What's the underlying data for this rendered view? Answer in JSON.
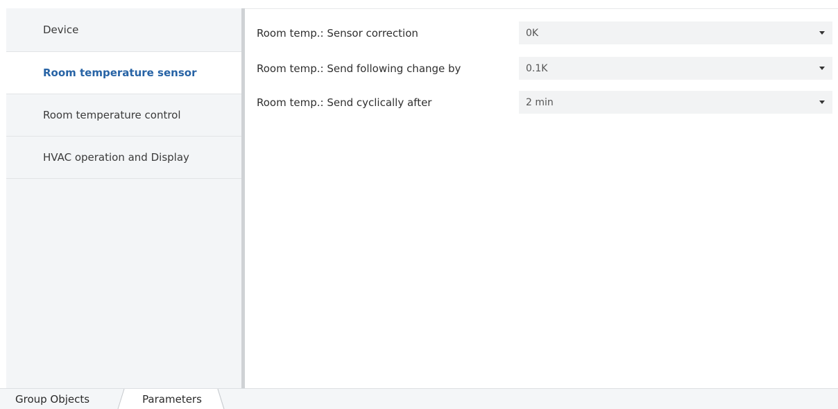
{
  "sidebar": {
    "items": [
      {
        "label": "Device",
        "active": false
      },
      {
        "label": "Room temperature sensor",
        "active": true
      },
      {
        "label": "Room temperature control",
        "active": false
      },
      {
        "label": "HVAC operation and Display",
        "active": false
      }
    ]
  },
  "parameters": [
    {
      "label": "Room temp.: Sensor correction",
      "value": "0K"
    },
    {
      "label": "Room temp.: Send following change by",
      "value": "0.1K"
    },
    {
      "label": "Room temp.: Send cyclically after",
      "value": "2 min"
    }
  ],
  "tabs": {
    "group_objects": "Group Objects",
    "parameters": "Parameters",
    "active": "Parameters"
  },
  "colors": {
    "accent": "#2763a5",
    "sidebar_bg": "#f3f5f7",
    "select_bg": "#f2f3f4"
  }
}
